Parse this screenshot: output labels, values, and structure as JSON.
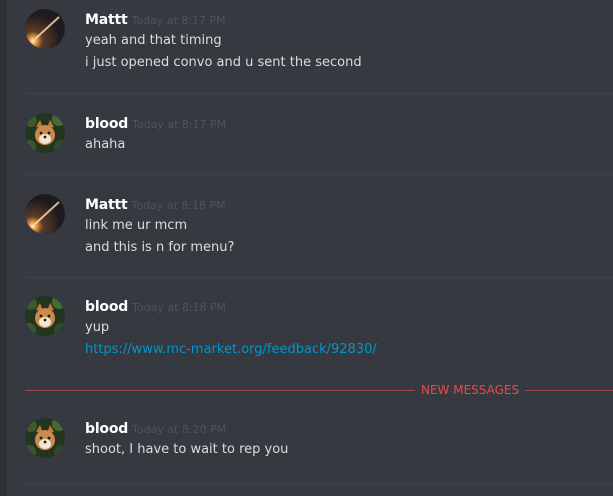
{
  "messages": [
    {
      "username": "Mattt",
      "timestamp": "Today at 8:17 PM",
      "avatar": "meteor-avatar",
      "lines": [
        "yeah and that timing",
        "i just opened convo and u sent the second"
      ]
    },
    {
      "username": "blood",
      "timestamp": "Today at 8:17 PM",
      "avatar": "shiba-avatar",
      "lines": [
        "ahaha"
      ]
    },
    {
      "username": "Mattt",
      "timestamp": "Today at 8:18 PM",
      "avatar": "meteor-avatar",
      "lines": [
        "link me ur mcm",
        "and this is n for menu?"
      ]
    },
    {
      "username": "blood",
      "timestamp": "Today at 8:18 PM",
      "avatar": "shiba-avatar",
      "lines": [
        "yup"
      ],
      "link": "https://www.mc-market.org/feedback/92830/"
    },
    {
      "username": "blood",
      "timestamp": "Today at 8:20 PM",
      "avatar": "shiba-avatar",
      "lines": [
        "shoot, I have to wait to rep you"
      ]
    }
  ],
  "new_messages_label": "NEW MESSAGES",
  "colors": {
    "background": "#36393f",
    "username": "#ffffff",
    "timestamp": "#4f535a",
    "message_text": "#dcddde",
    "link": "#0096cf",
    "new_messages": "#f04747"
  }
}
